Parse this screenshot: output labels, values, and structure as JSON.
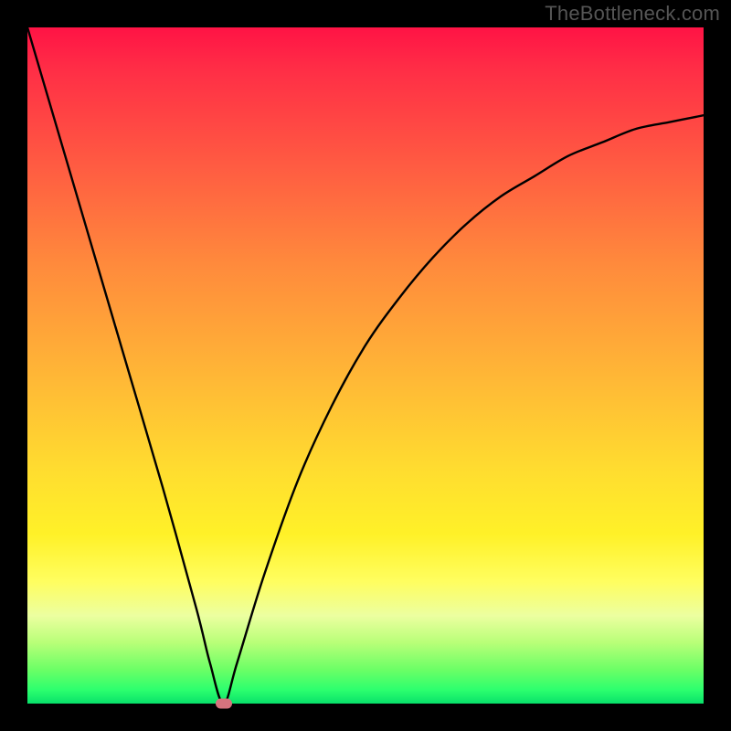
{
  "attribution": "TheBottleneck.com",
  "chart_data": {
    "type": "line",
    "title": "",
    "xlabel": "",
    "ylabel": "",
    "xlim": [
      0,
      100
    ],
    "ylim": [
      0,
      100
    ],
    "optimum_x": 29,
    "series": [
      {
        "name": "bottleneck-curve",
        "x": [
          0,
          5,
          10,
          15,
          20,
          25,
          27,
          29,
          31,
          35,
          40,
          45,
          50,
          55,
          60,
          65,
          70,
          75,
          80,
          85,
          90,
          95,
          100
        ],
        "values": [
          100,
          83,
          66,
          49,
          32,
          14,
          6,
          0,
          6,
          19,
          33,
          44,
          53,
          60,
          66,
          71,
          75,
          78,
          81,
          83,
          85,
          86,
          87
        ]
      }
    ],
    "marker": {
      "x": 29,
      "y": 0,
      "color": "#d6737e"
    },
    "gradient_stops": [
      {
        "pct": 0,
        "color": "#ff1345"
      },
      {
        "pct": 35,
        "color": "#ff8a3c"
      },
      {
        "pct": 66,
        "color": "#ffde2f"
      },
      {
        "pct": 87,
        "color": "#ecffa0"
      },
      {
        "pct": 100,
        "color": "#08e06a"
      }
    ]
  }
}
